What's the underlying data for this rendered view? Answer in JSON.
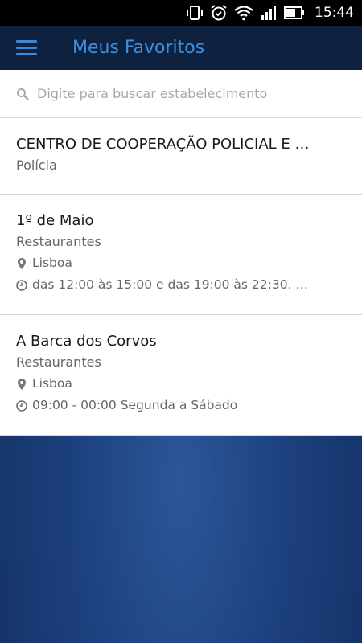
{
  "status_bar": {
    "time": "15:44",
    "icons": [
      "vibrate-icon",
      "alarm-icon",
      "wifi-icon",
      "signal-icon",
      "battery-icon"
    ]
  },
  "app_bar": {
    "title": "Meus Favoritos",
    "menu_icon": "hamburger-menu-icon",
    "title_color": "#3d8fe0",
    "background": "#0e223f"
  },
  "search": {
    "placeholder": "Digite para buscar estabelecimento",
    "value": ""
  },
  "favorites": [
    {
      "name": "CENTRO DE COOPERAÇÃO POLICIAL E …",
      "category": "Polícia"
    },
    {
      "name": "1º de Maio",
      "category": "Restaurantes",
      "location": "Lisboa",
      "hours": "das 12:00 às 15:00 e das 19:00 às 22:30. F…"
    },
    {
      "name": "A Barca dos Corvos",
      "category": "Restaurantes",
      "location": "Lisboa",
      "hours": "09:00 - 00:00 Segunda a Sábado"
    }
  ],
  "colors": {
    "background_gradient_center": "#2c5699",
    "background_gradient_edge": "#0f2a5a",
    "accent": "#3d86d4"
  }
}
